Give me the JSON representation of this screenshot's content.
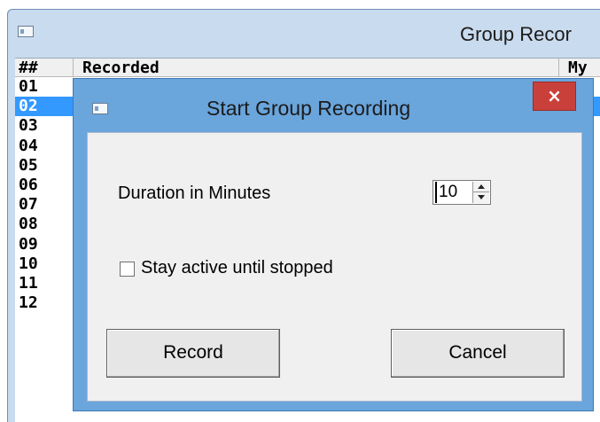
{
  "background_window": {
    "title": "Group Recor",
    "list": {
      "headers": {
        "number": "##",
        "recorded": "Recorded",
        "partial": "My"
      },
      "rows": [
        "01",
        "02",
        "03",
        "04",
        "05",
        "06",
        "07",
        "08",
        "09",
        "10",
        "11",
        "12"
      ],
      "selected_row": "02"
    }
  },
  "dialog": {
    "title": "Start Group Recording",
    "close_icon": "×",
    "duration": {
      "label": "Duration in Minutes",
      "value": "10"
    },
    "stay_active": {
      "label": "Stay active until stopped",
      "checked": false
    },
    "buttons": {
      "record": "Record",
      "cancel": "Cancel"
    }
  },
  "colors": {
    "frame_background": "#c9dbee",
    "dialog_frame": "#6aa5dc",
    "close_button": "#c9403a",
    "selection": "#3399ff"
  }
}
